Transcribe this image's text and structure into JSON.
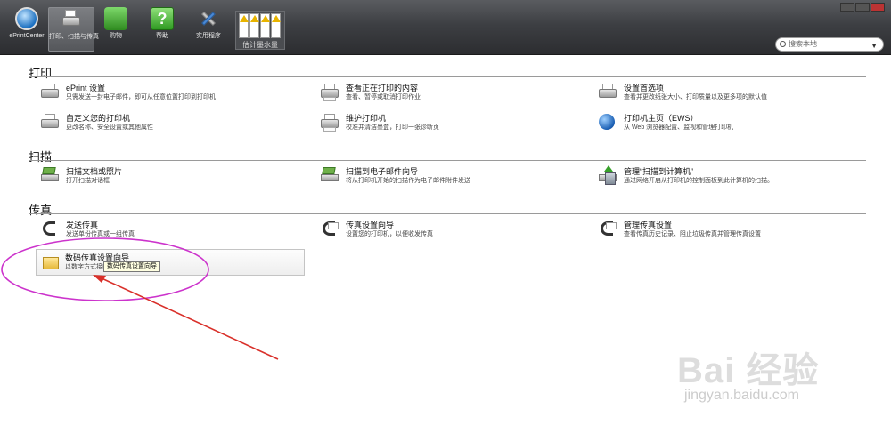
{
  "toolbar": {
    "items": [
      {
        "label": "ePrintCenter",
        "icon": "hp-logo-icon"
      },
      {
        "label": "打印、扫描与传真",
        "icon": "printer-icon",
        "active": true
      },
      {
        "label": "购物",
        "icon": "shopping-icon"
      },
      {
        "label": "帮助",
        "icon": "help-icon",
        "glyph": "?"
      },
      {
        "label": "实用程序",
        "icon": "tools-icon"
      }
    ],
    "ink_label": "估计墨水量",
    "search_placeholder": "搜索本地",
    "search_arrow": "▼"
  },
  "sections": [
    {
      "title": "打印",
      "items": [
        {
          "title": "ePrint 设置",
          "desc": "只需发送一封电子邮件，即可从任意位置打印到打印机"
        },
        {
          "title": "查看正在打印的内容",
          "desc": "查看、暂停或取消打印作业"
        },
        {
          "title": "设置首选项",
          "desc": "查看并更改纸张大小、打印质量以及更多项的默认值"
        },
        {
          "title": "自定义您的打印机",
          "desc": "更改名称、安全设置或其他属性"
        },
        {
          "title": "维护打印机",
          "desc": "校准并清洁墨盒，打印一张诊断页"
        },
        {
          "title": "打印机主页（EWS）",
          "desc": "从 Web 浏览器配置、监视和管理打印机"
        }
      ]
    },
    {
      "title": "扫描",
      "items": [
        {
          "title": "扫描文档或照片",
          "desc": "打开扫描对话框"
        },
        {
          "title": "扫描到电子邮件向导",
          "desc": "将从打印机开始的扫描作为电子邮件附件发送"
        },
        {
          "title": "管理“扫描到计算机”",
          "desc": "通过网络开启从打印机的控制面板到此计算机的扫描。"
        }
      ]
    },
    {
      "title": "传真",
      "items": [
        {
          "title": "发送传真",
          "desc": "发送单份传真或一组传真"
        },
        {
          "title": "传真设置向导",
          "desc": "设置您的打印机，以便收发传真"
        },
        {
          "title": "管理传真设置",
          "desc": "查看传真历史记录、阻止垃圾传真并管理传真设置"
        },
        {
          "title": "数码传真设置向导",
          "desc": "以数字方式接收和存储传入传真"
        }
      ]
    }
  ],
  "tooltip": "数码传真设置向导",
  "watermark": {
    "brand": "Bai 经验",
    "url": "jingyan.baidu.com"
  },
  "colors": {
    "annotation": "#cc33cc",
    "arrow": "#d9302a"
  }
}
